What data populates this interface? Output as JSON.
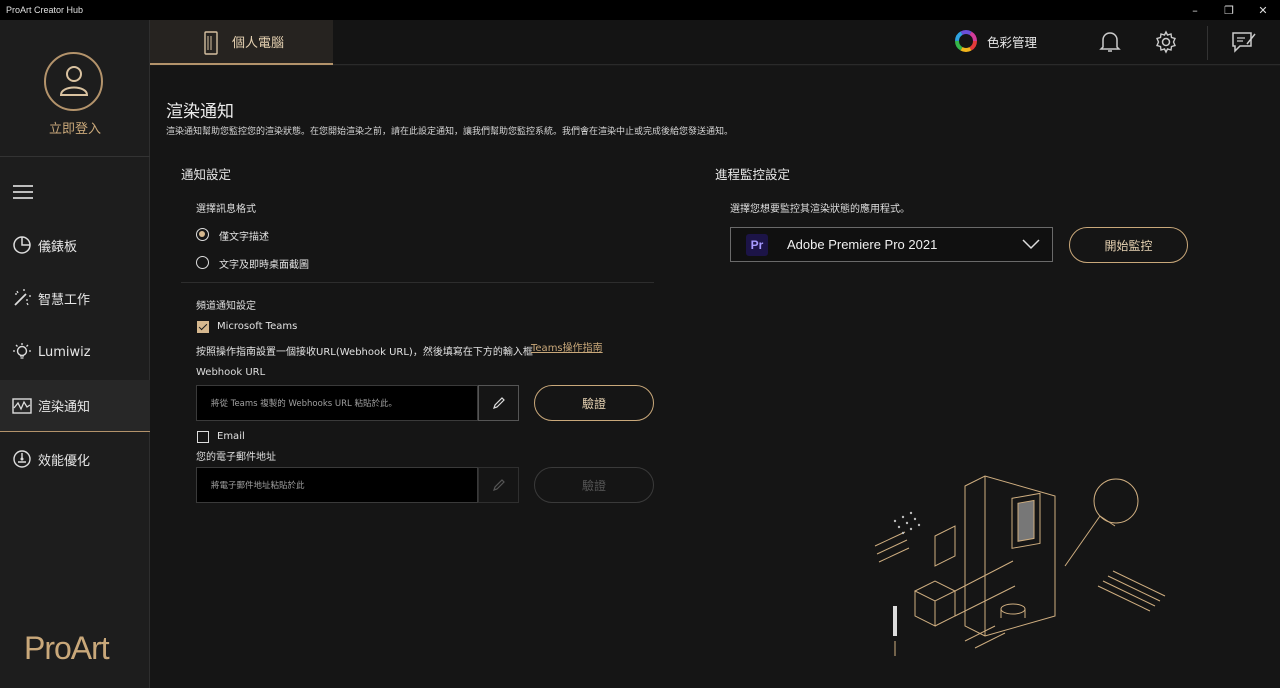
{
  "window": {
    "title": "ProArt Creator Hub",
    "controls": [
      "–",
      "❐",
      "✕"
    ]
  },
  "sidebar": {
    "login_label": "立即登入",
    "items": [
      {
        "label": "儀錶板",
        "icon": "dashboard-gauge-icon"
      },
      {
        "label": "智慧工作",
        "icon": "magic-wand-icon"
      },
      {
        "label": "Lumiwiz",
        "icon": "lightbulb-icon"
      },
      {
        "label": "渲染通知",
        "icon": "waveform-monitor-icon",
        "active": true
      },
      {
        "label": "效能優化",
        "icon": "performance-gauge-icon"
      }
    ],
    "logo": "ProArt"
  },
  "topbar": {
    "tab_pc": "個人電腦",
    "color_management": "色彩管理"
  },
  "page": {
    "title": "渲染通知",
    "description": "渲染通知幫助您監控您的渲染狀態。在您開始渲染之前，請在此設定通知，讓我們幫助您監控系統。我們會在渲染中止或完成後給您發送通知。"
  },
  "notification_settings": {
    "title": "通知設定",
    "format_label": "選擇訊息格式",
    "format_options": [
      {
        "label": "僅文字描述",
        "selected": true
      },
      {
        "label": "文字及即時桌面截圖",
        "selected": false
      }
    ],
    "channel_label": "頻道通知設定",
    "teams": {
      "label": "Microsoft Teams",
      "checked": true,
      "instruction": "按照操作指南設置一個接收URL(Webhook URL)，然後填寫在下方的輸入框",
      "guide_link": "Teams操作指南",
      "webhook_label": "Webhook URL",
      "webhook_placeholder": "將從 Teams 複製的 Webhooks URL 粘貼於此。",
      "verify_button": "驗證"
    },
    "email": {
      "label": "Email",
      "checked": false,
      "address_label": "您的電子郵件地址",
      "placeholder": "將電子郵件地址粘貼於此",
      "verify_button": "驗證"
    }
  },
  "process_monitor": {
    "title": "進程監控設定",
    "instruction": "選擇您想要監控其渲染狀態的應用程式。",
    "selected_app": "Adobe Premiere Pro 2021",
    "app_badge": "Pr",
    "start_button": "開始監控"
  },
  "colors": {
    "accent": "#c9a87a",
    "background": "#151515",
    "sidebar": "#1d1d1d"
  }
}
